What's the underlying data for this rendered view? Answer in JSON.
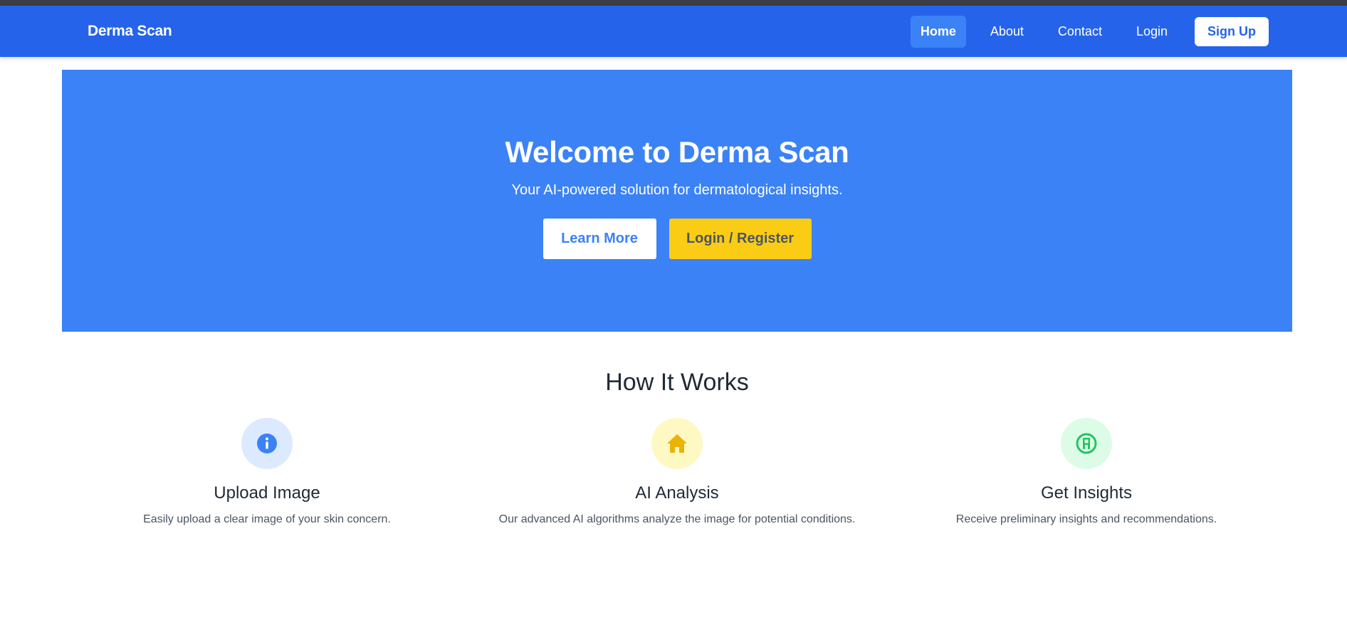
{
  "navbar": {
    "brand": "Derma Scan",
    "links": [
      {
        "label": "Home",
        "active": true
      },
      {
        "label": "About",
        "active": false
      },
      {
        "label": "Contact",
        "active": false
      },
      {
        "label": "Login",
        "active": false
      }
    ],
    "signup_label": "Sign Up"
  },
  "hero": {
    "title": "Welcome to Derma Scan",
    "subtitle": "Your AI-powered solution for dermatological insights.",
    "learn_more_label": "Learn More",
    "login_register_label": "Login / Register"
  },
  "how_it_works": {
    "title": "How It Works",
    "features": [
      {
        "icon": "info-icon",
        "icon_color": "#3b82f6",
        "icon_bg": "#dbeafe",
        "title": "Upload Image",
        "description": "Easily upload a clear image of your skin concern."
      },
      {
        "icon": "home-icon",
        "icon_color": "#eab308",
        "icon_bg": "#fef9c3",
        "title": "AI Analysis",
        "description": "Our advanced AI algorithms analyze the image for potential conditions."
      },
      {
        "icon": "insights-icon",
        "icon_color": "#22c55e",
        "icon_bg": "#dcfce7",
        "title": "Get Insights",
        "description": "Receive preliminary insights and recommendations."
      }
    ]
  },
  "colors": {
    "navbar": "#2563eb",
    "hero": "#3b82f6",
    "accent_yellow": "#facc15"
  }
}
